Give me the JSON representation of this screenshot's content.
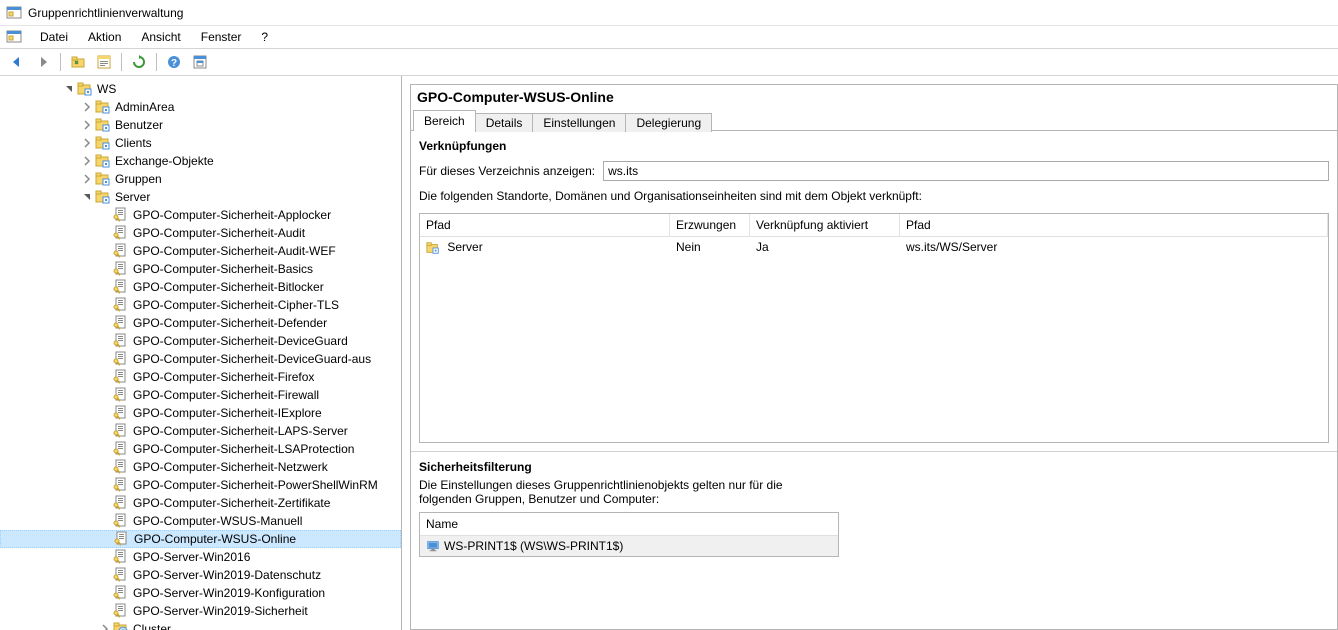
{
  "window_title": "Gruppenrichtlinienverwaltung",
  "menubar": [
    "Datei",
    "Aktion",
    "Ansicht",
    "Fenster",
    "?"
  ],
  "tree": {
    "root": "WS",
    "ous": [
      "AdminArea",
      "Benutzer",
      "Clients",
      "Exchange-Objekte",
      "Gruppen"
    ],
    "server_label": "Server",
    "gpos": [
      "GPO-Computer-Sicherheit-Applocker",
      "GPO-Computer-Sicherheit-Audit",
      "GPO-Computer-Sicherheit-Audit-WEF",
      "GPO-Computer-Sicherheit-Basics",
      "GPO-Computer-Sicherheit-Bitlocker",
      "GPO-Computer-Sicherheit-Cipher-TLS",
      "GPO-Computer-Sicherheit-Defender",
      "GPO-Computer-Sicherheit-DeviceGuard",
      "GPO-Computer-Sicherheit-DeviceGuard-aus",
      "GPO-Computer-Sicherheit-Firefox",
      "GPO-Computer-Sicherheit-Firewall",
      "GPO-Computer-Sicherheit-IExplore",
      "GPO-Computer-Sicherheit-LAPS-Server",
      "GPO-Computer-Sicherheit-LSAProtection",
      "GPO-Computer-Sicherheit-Netzwerk",
      "GPO-Computer-Sicherheit-PowerShellWinRM",
      "GPO-Computer-Sicherheit-Zertifikate",
      "GPO-Computer-WSUS-Manuell",
      "GPO-Computer-WSUS-Online",
      "GPO-Server-Win2016",
      "GPO-Server-Win2019-Datenschutz",
      "GPO-Server-Win2019-Konfiguration",
      "GPO-Server-Win2019-Sicherheit"
    ],
    "selected": "GPO-Computer-WSUS-Online",
    "cluster": "Cluster"
  },
  "content": {
    "title": "GPO-Computer-WSUS-Online",
    "tabs": [
      "Bereich",
      "Details",
      "Einstellungen",
      "Delegierung"
    ],
    "active_tab": "Bereich",
    "links": {
      "heading": "Verknüpfungen",
      "dir_label": "Für dieses Verzeichnis anzeigen:",
      "dir_value": "ws.its",
      "desc": "Die folgenden Standorte, Domänen und Organisationseinheiten sind mit dem Objekt verknüpft:",
      "cols": [
        "Pfad",
        "Erzwungen",
        "Verknüpfung aktiviert",
        "Pfad"
      ],
      "row": {
        "pfad": "Server",
        "erzw": "Nein",
        "aktiv": "Ja",
        "pfad2": "ws.its/WS/Server"
      }
    },
    "secfilter": {
      "heading": "Sicherheitsfilterung",
      "desc": "Die Einstellungen dieses Gruppenrichtlinienobjekts gelten nur für die folgenden Gruppen, Benutzer und Computer:",
      "col": "Name",
      "row": "WS-PRINT1$ (WS\\WS-PRINT1$)"
    }
  }
}
